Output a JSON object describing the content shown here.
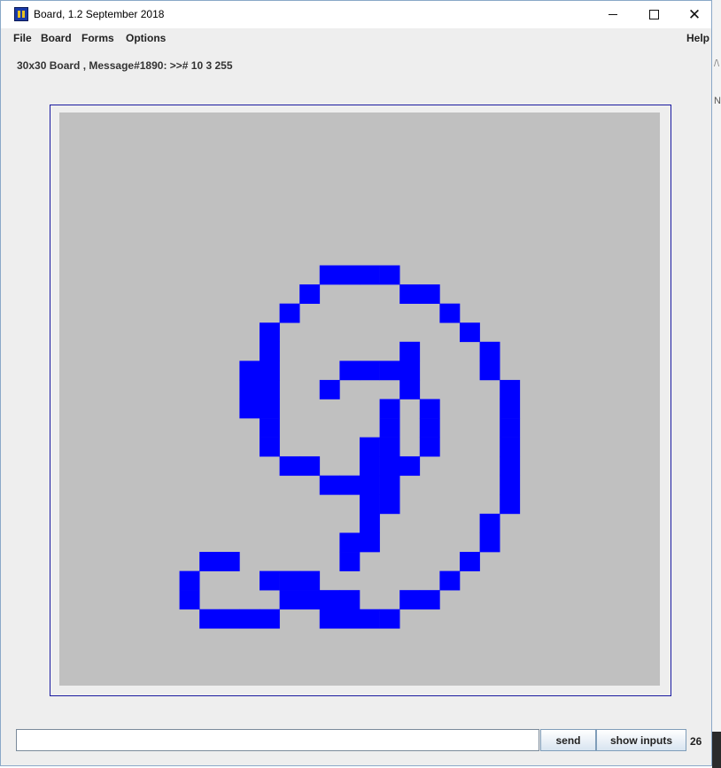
{
  "window": {
    "title": "Board, 1.2 September 2018",
    "controls": {
      "minimize": "minimize",
      "maximize": "maximize",
      "close": "✕"
    }
  },
  "menu": {
    "items": [
      "File",
      "Board",
      "Forms",
      "Options"
    ],
    "help": "Help"
  },
  "status": {
    "text": "30x30 Board , Message#1890: >># 10 3 255"
  },
  "board": {
    "rows": 30,
    "cols": 30,
    "background_color": "#c0c0c0",
    "cell_color": "#0000ff",
    "filled_cells": [
      [
        8,
        13
      ],
      [
        8,
        14
      ],
      [
        8,
        15
      ],
      [
        8,
        16
      ],
      [
        9,
        12
      ],
      [
        9,
        17
      ],
      [
        9,
        18
      ],
      [
        10,
        11
      ],
      [
        10,
        19
      ],
      [
        11,
        10
      ],
      [
        11,
        20
      ],
      [
        12,
        10
      ],
      [
        12,
        17
      ],
      [
        12,
        21
      ],
      [
        13,
        9
      ],
      [
        13,
        10
      ],
      [
        13,
        14
      ],
      [
        13,
        15
      ],
      [
        13,
        16
      ],
      [
        13,
        17
      ],
      [
        13,
        21
      ],
      [
        14,
        9
      ],
      [
        14,
        10
      ],
      [
        14,
        13
      ],
      [
        14,
        17
      ],
      [
        14,
        22
      ],
      [
        15,
        9
      ],
      [
        15,
        10
      ],
      [
        15,
        16
      ],
      [
        15,
        18
      ],
      [
        15,
        22
      ],
      [
        16,
        10
      ],
      [
        16,
        16
      ],
      [
        16,
        18
      ],
      [
        16,
        22
      ],
      [
        17,
        10
      ],
      [
        17,
        15
      ],
      [
        17,
        16
      ],
      [
        17,
        18
      ],
      [
        17,
        22
      ],
      [
        18,
        11
      ],
      [
        18,
        12
      ],
      [
        18,
        15
      ],
      [
        18,
        16
      ],
      [
        18,
        17
      ],
      [
        18,
        22
      ],
      [
        19,
        13
      ],
      [
        19,
        14
      ],
      [
        19,
        15
      ],
      [
        19,
        16
      ],
      [
        19,
        22
      ],
      [
        20,
        15
      ],
      [
        20,
        16
      ],
      [
        20,
        22
      ],
      [
        21,
        15
      ],
      [
        21,
        21
      ],
      [
        22,
        14
      ],
      [
        22,
        15
      ],
      [
        22,
        21
      ],
      [
        23,
        7
      ],
      [
        23,
        8
      ],
      [
        23,
        14
      ],
      [
        23,
        20
      ],
      [
        24,
        6
      ],
      [
        24,
        10
      ],
      [
        24,
        11
      ],
      [
        24,
        12
      ],
      [
        24,
        19
      ],
      [
        25,
        6
      ],
      [
        25,
        11
      ],
      [
        25,
        12
      ],
      [
        25,
        13
      ],
      [
        25,
        14
      ],
      [
        25,
        17
      ],
      [
        25,
        18
      ],
      [
        26,
        7
      ],
      [
        26,
        8
      ],
      [
        26,
        9
      ],
      [
        26,
        10
      ],
      [
        26,
        13
      ],
      [
        26,
        14
      ],
      [
        26,
        15
      ],
      [
        26,
        16
      ]
    ]
  },
  "input": {
    "value": ""
  },
  "buttons": {
    "send": "send",
    "show_inputs": "show inputs"
  },
  "count": "26"
}
